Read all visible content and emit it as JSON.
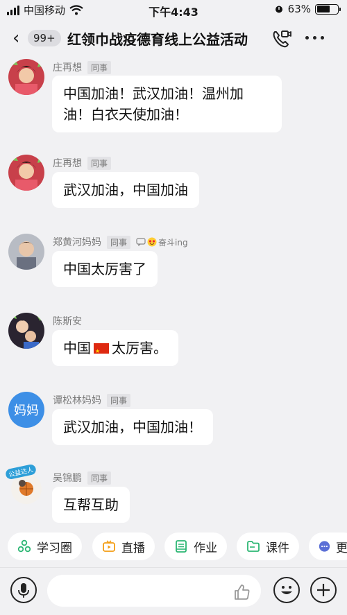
{
  "status_bar": {
    "carrier": "中国移动",
    "time": "下午4:43",
    "battery": "63%",
    "battery_level": 0.63
  },
  "nav": {
    "unread_badge": "99+",
    "title": "红领巾战疫德育线上公益活动"
  },
  "messages": [
    {
      "sender": "庄再想",
      "tag": "同事",
      "text": "中国加油！武汉加油！温州加油！白衣天使加油！"
    },
    {
      "sender": "庄再想",
      "tag": "同事",
      "text": "武汉加油，中国加油"
    },
    {
      "sender": "郑黄河妈妈",
      "tag": "同事",
      "status": "奋斗ing",
      "text": "中国太厉害了"
    },
    {
      "sender": "陈斯安",
      "text_before": "中国",
      "text_after": "太厉害。"
    },
    {
      "sender": "谭松林妈妈",
      "tag": "同事",
      "avatar_text": "妈妈",
      "text": "武汉加油，中国加油！"
    },
    {
      "sender": "吴锦鹏",
      "tag": "同事",
      "avatar_badge": "公益达人",
      "text": "互帮互助"
    }
  ],
  "shortcuts": [
    {
      "label": "学习圈",
      "icon": "circle-triad-icon"
    },
    {
      "label": "直播",
      "icon": "live-tv-icon"
    },
    {
      "label": "作业",
      "icon": "homework-book-icon"
    },
    {
      "label": "课件",
      "icon": "folder-icon"
    },
    {
      "label": "更",
      "icon": "more-dots-icon"
    }
  ],
  "input": {
    "placeholder": ""
  },
  "colors": {
    "accent": "#2bb673",
    "bg": "#f1f1f3",
    "bubble": "#ffffff",
    "orange": "#f39c12"
  }
}
